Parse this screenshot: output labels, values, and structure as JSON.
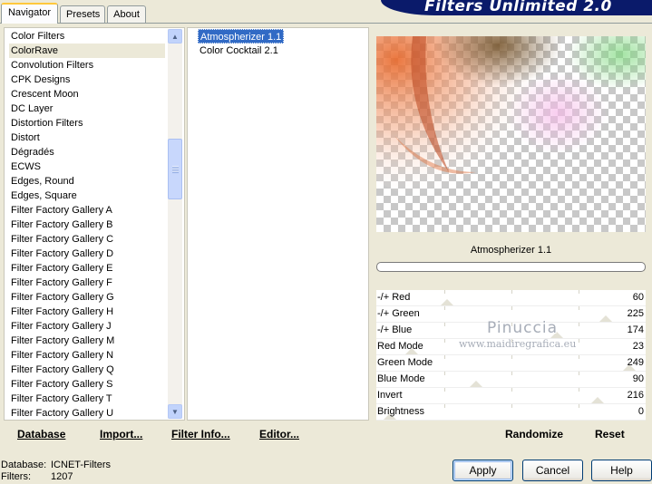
{
  "tabs": [
    {
      "label": "Navigator",
      "active": true
    },
    {
      "label": "Presets",
      "active": false
    },
    {
      "label": "About",
      "active": false
    }
  ],
  "app_title": "Filters Unlimited 2.0",
  "categories": [
    "Color Filters",
    "ColorRave",
    "Convolution Filters",
    "CPK Designs",
    "Crescent Moon",
    "DC Layer",
    "Distortion Filters",
    "Distort",
    "Dégradés",
    "ECWS",
    "Edges, Round",
    "Edges, Square",
    "Filter Factory Gallery A",
    "Filter Factory Gallery B",
    "Filter Factory Gallery C",
    "Filter Factory Gallery D",
    "Filter Factory Gallery E",
    "Filter Factory Gallery F",
    "Filter Factory Gallery G",
    "Filter Factory Gallery H",
    "Filter Factory Gallery J",
    "Filter Factory Gallery M",
    "Filter Factory Gallery N",
    "Filter Factory Gallery Q",
    "Filter Factory Gallery S",
    "Filter Factory Gallery T",
    "Filter Factory Gallery U"
  ],
  "selected_category": "ColorRave",
  "filters": [
    "Atmospherizer 1.1",
    "Color Cocktail 2.1"
  ],
  "selected_filter": "Atmospherizer 1.1",
  "preview_title": "Atmospherizer 1.1",
  "sliders": [
    {
      "label": "-/+ Red",
      "value": "60",
      "fraction": 0.235
    },
    {
      "label": "-/+ Green",
      "value": "225",
      "fraction": 0.882
    },
    {
      "label": "-/+ Blue",
      "value": "174",
      "fraction": 0.682
    },
    {
      "label": "Red Mode",
      "value": "23",
      "fraction": 0.09
    },
    {
      "label": "Green Mode",
      "value": "249",
      "fraction": 0.976
    },
    {
      "label": "Blue Mode",
      "value": "90",
      "fraction": 0.353
    },
    {
      "label": "Invert",
      "value": "216",
      "fraction": 0.847
    },
    {
      "label": "Brightness",
      "value": "0",
      "fraction": 0.0
    }
  ],
  "toolbar": {
    "database": "Database",
    "import": "Import...",
    "filter_info": "Filter Info...",
    "editor": "Editor...",
    "randomize": "Randomize",
    "reset": "Reset"
  },
  "status": {
    "database_label": "Database:",
    "database_value": "ICNET-Filters",
    "filters_label": "Filters:",
    "filters_value": "1207"
  },
  "buttons": {
    "apply": "Apply",
    "cancel": "Cancel",
    "help": "Help"
  },
  "watermark": {
    "name": "Pinuccia",
    "url": "www.maidiregrafica.eu"
  }
}
